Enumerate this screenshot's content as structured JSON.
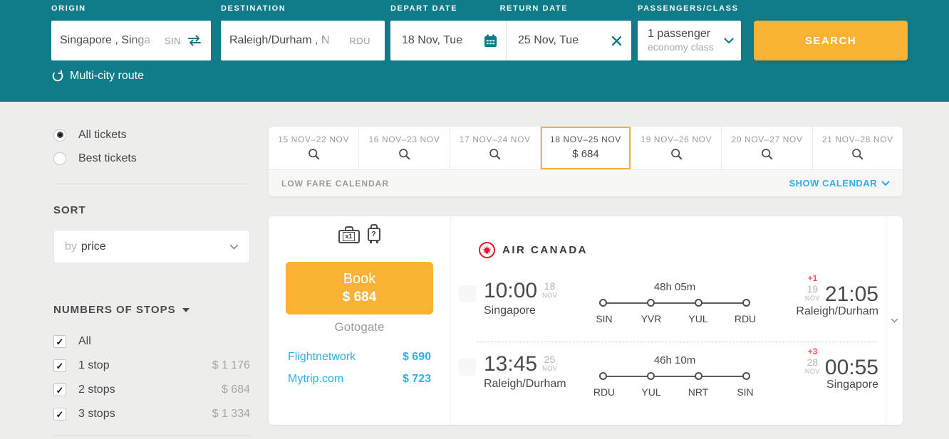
{
  "colors": {
    "teal": "#117c89",
    "orange": "#f9b234",
    "link_blue": "#29b2ea",
    "offset_red": "#f4564f",
    "airline_red": "#e8112d"
  },
  "search_form": {
    "origin": {
      "label": "ORIGIN",
      "value": "Singapore , Singa",
      "code": "SIN"
    },
    "destination": {
      "label": "DESTINATION",
      "value": "Raleigh/Durham , N",
      "code": "RDU"
    },
    "depart": {
      "label": "DEPART DATE",
      "value": "18 Nov, Tue"
    },
    "return": {
      "label": "RETURN DATE",
      "value": "25 Nov, Tue"
    },
    "passengers": {
      "label": "PASSENGERS/CLASS",
      "count": "1 passenger",
      "class": "economy class"
    },
    "search_label": "SEARCH",
    "multicity_label": "Multi-city route"
  },
  "sidebar": {
    "ticket_filters": [
      {
        "label": "All tickets",
        "selected": true
      },
      {
        "label": "Best tickets",
        "selected": false
      }
    ],
    "sort": {
      "heading": "SORT",
      "prefix": "by",
      "value": "price"
    },
    "stops": {
      "heading": "NUMBERS OF STOPS",
      "options": [
        {
          "label": "All",
          "checked": true
        },
        {
          "label": "1 stop",
          "checked": true,
          "price": "$ 1 176"
        },
        {
          "label": "2 stops",
          "checked": true,
          "price": "$ 684"
        },
        {
          "label": "3 stops",
          "checked": true,
          "price": "$ 1 334"
        }
      ]
    }
  },
  "date_tabs": {
    "tabs": [
      {
        "range": "15 NOV–22 NOV"
      },
      {
        "range": "16 NOV–23 NOV"
      },
      {
        "range": "17 NOV–24 NOV"
      },
      {
        "range": "18 NOV–25 NOV",
        "price": "$ 684",
        "selected": true
      },
      {
        "range": "19 NOV–26 NOV"
      },
      {
        "range": "20 NOV–27 NOV"
      },
      {
        "range": "21 NOV–28 NOV"
      }
    ],
    "low_fare_label": "LOW FARE CALENDAR",
    "show_calendar_label": "SHOW CALENDAR"
  },
  "result": {
    "baggage": {
      "cabin_label": "x1",
      "checked_label": "?"
    },
    "book": {
      "label": "Book",
      "price": "$ 684",
      "vendor": "Gotogate"
    },
    "alternatives": [
      {
        "vendor": "Flightnetwork",
        "price": "$ 690"
      },
      {
        "vendor": "Mytrip.com",
        "price": "$ 723"
      }
    ],
    "airline": "AIR CANADA",
    "legs": [
      {
        "depart_time": "10:00",
        "depart_day": "18",
        "depart_month": "NOV",
        "depart_city": "Singapore",
        "duration": "48h 05m",
        "stops": [
          "SIN",
          "YVR",
          "YUL",
          "RDU"
        ],
        "day_offset": "+1",
        "arrive_day": "19",
        "arrive_month": "NOV",
        "arrive_time": "21:05",
        "arrive_city": "Raleigh/Durham"
      },
      {
        "depart_time": "13:45",
        "depart_day": "25",
        "depart_month": "NOV",
        "depart_city": "Raleigh/Durham",
        "duration": "46h 10m",
        "stops": [
          "RDU",
          "YUL",
          "NRT",
          "SIN"
        ],
        "day_offset": "+3",
        "arrive_day": "28",
        "arrive_month": "NOV",
        "arrive_time": "00:55",
        "arrive_city": "Singapore"
      }
    ]
  }
}
